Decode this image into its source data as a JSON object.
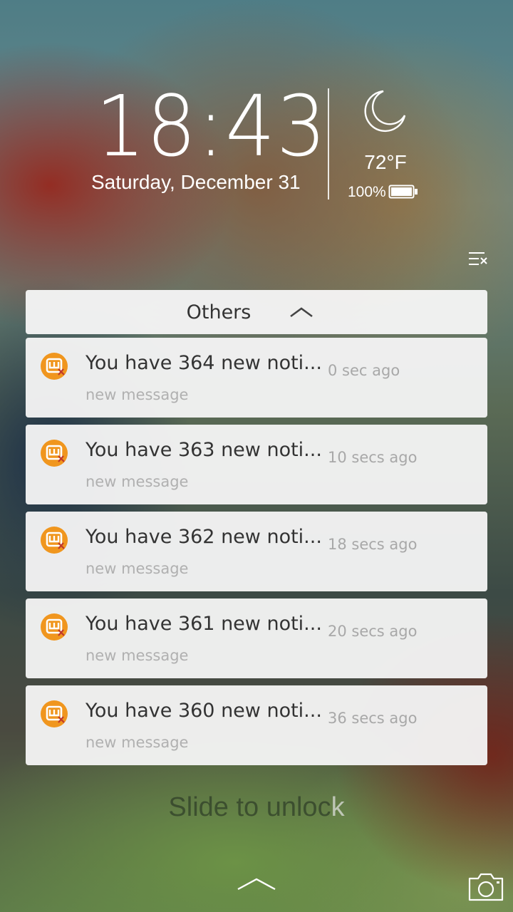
{
  "lockscreen": {
    "time": "18:43",
    "date": "Saturday, December 31",
    "weather": {
      "icon": "moon-icon",
      "temperature": "72°F"
    },
    "battery": {
      "percent_text": "100%",
      "level": 1.0
    },
    "clear_all_icon": "clear-all-icon"
  },
  "group": {
    "title": "Others",
    "expanded": true
  },
  "notifications": [
    {
      "title": "You have 364 new noti...",
      "time": "0 sec ago",
      "subtitle": "new message"
    },
    {
      "title": "You have 363 new noti...",
      "time": "10 secs ago",
      "subtitle": "new message"
    },
    {
      "title": "You have 362 new noti...",
      "time": "18 secs ago",
      "subtitle": "new message"
    },
    {
      "title": "You have 361 new noti...",
      "time": "20 secs ago",
      "subtitle": "new message"
    },
    {
      "title": "You have 360 new noti...",
      "time": "36 secs ago",
      "subtitle": "new message"
    }
  ],
  "unlock": {
    "hint_main": "Slide to unloc",
    "hint_tail": "k"
  },
  "colors": {
    "app_icon": "#f0961e",
    "card_bg": "#f4f4f4",
    "text_dark": "#333333",
    "text_muted": "#a8a8a8"
  }
}
